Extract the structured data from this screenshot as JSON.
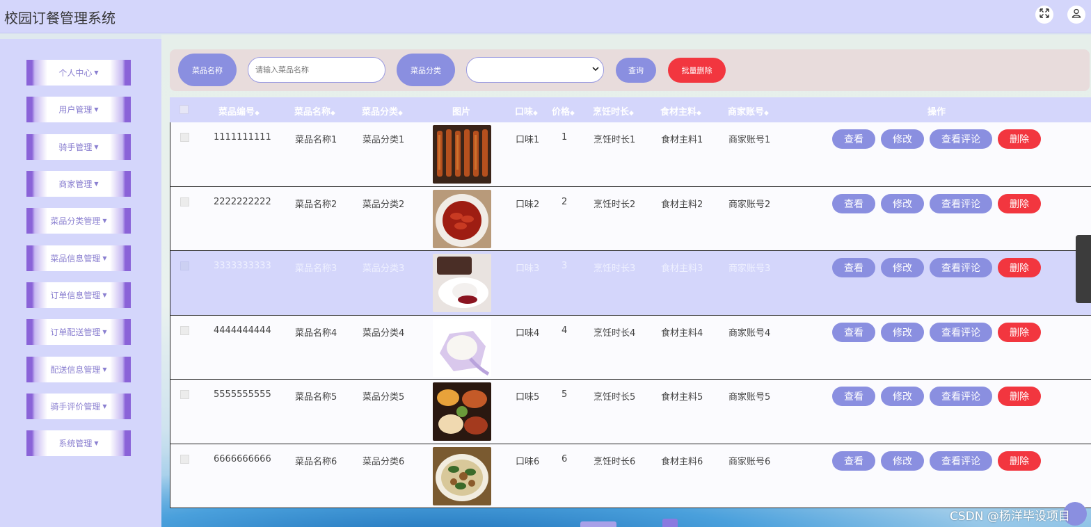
{
  "header": {
    "title": "校园订餐管理系统",
    "fullscreen_icon": "expand-icon",
    "user_icon": "user-icon"
  },
  "sidebar": {
    "items": [
      {
        "label": "个人中心"
      },
      {
        "label": "用户管理"
      },
      {
        "label": "骑手管理"
      },
      {
        "label": "商家管理"
      },
      {
        "label": "菜品分类管理"
      },
      {
        "label": "菜品信息管理"
      },
      {
        "label": "订单信息管理"
      },
      {
        "label": "订单配送管理"
      },
      {
        "label": "配送信息管理"
      },
      {
        "label": "骑手评价管理"
      },
      {
        "label": "系统管理"
      }
    ]
  },
  "search": {
    "name_label": "菜品名称",
    "name_placeholder": "请输入菜品名称",
    "category_label": "菜品分类",
    "category_value": "",
    "query_button": "查询",
    "batch_delete_button": "批量删除"
  },
  "table": {
    "columns": [
      "菜品编号",
      "菜品名称",
      "菜品分类",
      "图片",
      "口味",
      "价格",
      "烹饪时长",
      "食材主料",
      "商家账号",
      "操作"
    ],
    "actions": [
      "查看",
      "修改",
      "查看评论",
      "删除"
    ],
    "rows": [
      {
        "id": "1111111111",
        "name": "菜品名称1",
        "category": "菜品分类1",
        "flavor": "口味1",
        "price": "1",
        "cook_time": "烹饪时长1",
        "ingredient": "食材主料1",
        "merchant": "商家账号1"
      },
      {
        "id": "2222222222",
        "name": "菜品名称2",
        "category": "菜品分类2",
        "flavor": "口味2",
        "price": "2",
        "cook_time": "烹饪时长2",
        "ingredient": "食材主料2",
        "merchant": "商家账号2"
      },
      {
        "id": "3333333333",
        "name": "菜品名称3",
        "category": "菜品分类3",
        "flavor": "口味3",
        "price": "3",
        "cook_time": "烹饪时长3",
        "ingredient": "食材主料3",
        "merchant": "商家账号3"
      },
      {
        "id": "4444444444",
        "name": "菜品名称4",
        "category": "菜品分类4",
        "flavor": "口味4",
        "price": "4",
        "cook_time": "烹饪时长4",
        "ingredient": "食材主料4",
        "merchant": "商家账号4"
      },
      {
        "id": "5555555555",
        "name": "菜品名称5",
        "category": "菜品分类5",
        "flavor": "口味5",
        "price": "5",
        "cook_time": "烹饪时长5",
        "ingredient": "食材主料5",
        "merchant": "商家账号5"
      },
      {
        "id": "6666666666",
        "name": "菜品名称6",
        "category": "菜品分类6",
        "flavor": "口味6",
        "price": "6",
        "cook_time": "烹饪时长6",
        "ingredient": "食材主料6",
        "merchant": "商家账号6"
      }
    ]
  },
  "watermark": "CSDN @杨洋毕设项目",
  "colors": {
    "header_bg": "#d4d6fb",
    "accent": "#8a8fe0",
    "danger": "#f2363f",
    "sidebar_stripe": "#8a63d8"
  }
}
